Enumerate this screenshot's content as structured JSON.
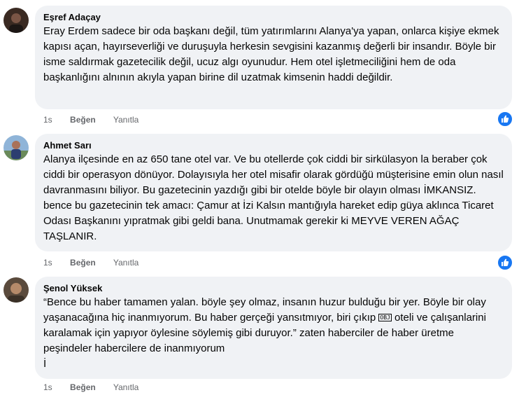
{
  "comments": [
    {
      "author": "Eşref Adaçay",
      "text": "Eray Erdem sadece bir oda başkanı değil, tüm yatırımlarını Alanya'ya yapan, onlarca kişiye ekmek kapısı açan, hayırseverliği ve duruşuyla herkesin sevgisini kazanmış değerli bir insandır. Böyle bir isme saldırmak gazetecilik değil, ucuz algı oyunudur. Hem otel işletmeciliğini hem de oda başkanlığını alnının akıyla yapan birine dil uzatmak kimsenin haddi değildir.",
      "time": "1s",
      "like_label": "Beğen",
      "reply_label": "Yanıtla",
      "has_like": true
    },
    {
      "author": "Ahmet Sarı",
      "text": "Alanya ilçesinde en az 650 tane otel var. Ve bu otellerde çok ciddi bir sirkülasyon la beraber çok ciddi bir operasyon dönüyor. Dolayısıyla her otel misafir olarak gördüğü müşterisine emin olun nasıl davranmasını biliyor. Bu gazetecinin yazdığı gibi bir otelde böyle bir olayın olması İMKANSIZ. bence bu gazetecinin tek amacı: Çamur at İzi Kalsın mantığıyla hareket edip güya aklınca Ticaret Odası Başkanını yıpratmak gibi geldi bana. Unutmamak gerekir ki MEYVE VEREN AĞAÇ TAŞLANIR.",
      "time": "1s",
      "like_label": "Beğen",
      "reply_label": "Yanıtla",
      "has_like": true
    },
    {
      "author": "Şenol Yüksek",
      "text_part1": "“Bence bu haber tamamen yalan. böyle şey olmaz, insanın huzur bulduğu bir yer. Böyle bir olay yaşanacağına hiç inanmıyorum. Bu haber gerçeği yansıtmıyor, biri çıkıp ",
      "obj_glyph": "OBJ",
      "text_part2": " oteli ve çalışanlarini karalamak için yapıyor öylesine söylemiş gibi duruyor.” zaten haberciler de haber üretme peşindeler habercilere de inanmıyorum",
      "text_last": "İ",
      "time": "1s",
      "like_label": "Beğen",
      "reply_label": "Yanıtla",
      "has_like": false
    }
  ],
  "icons": {
    "like": "thumbs-up-icon"
  },
  "colors": {
    "bubble": "#f0f2f5",
    "like_blue": "#1877f2",
    "meta_gray": "#65676b"
  }
}
